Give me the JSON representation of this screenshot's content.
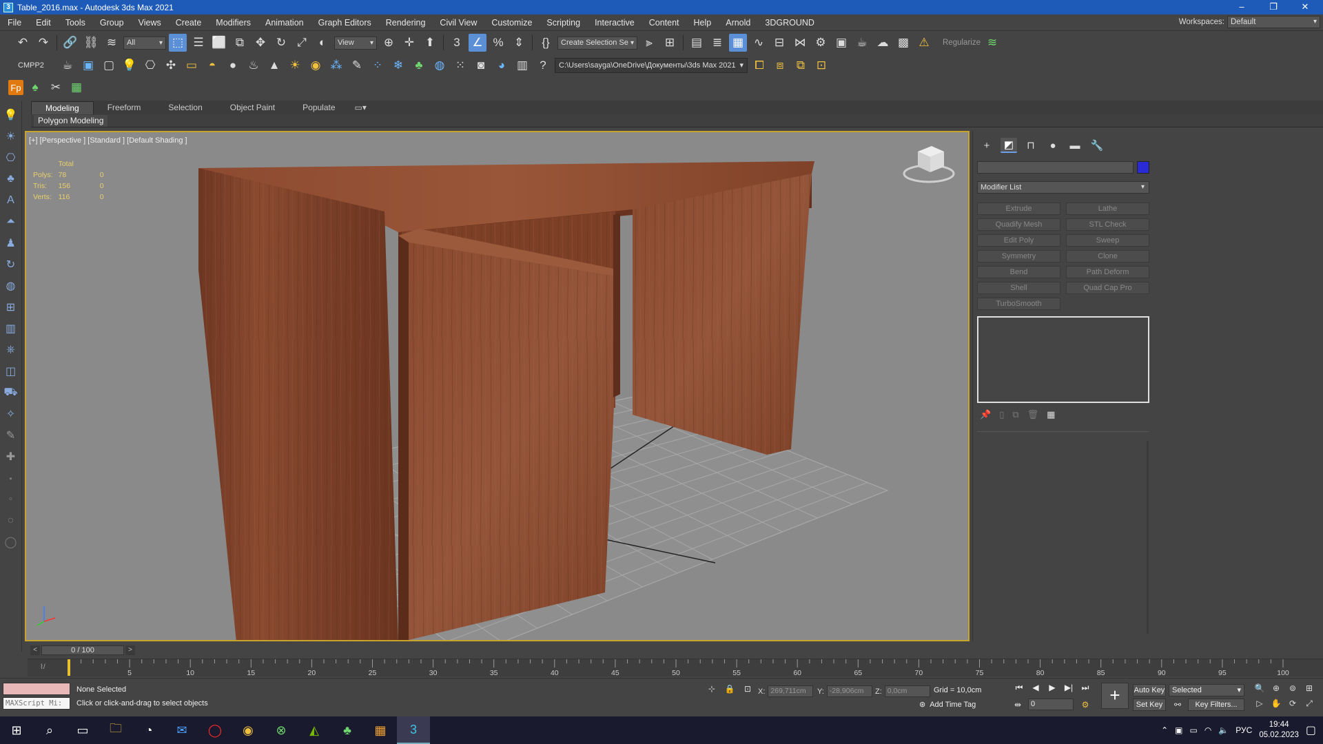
{
  "window": {
    "title": "Table_2016.max - Autodesk 3ds Max 2021",
    "app_icon": "3",
    "controls": [
      "–",
      "❐",
      "✕"
    ]
  },
  "menu": [
    "File",
    "Edit",
    "Tools",
    "Group",
    "Views",
    "Create",
    "Modifiers",
    "Animation",
    "Graph Editors",
    "Rendering",
    "Civil View",
    "Customize",
    "Scripting",
    "Interactive",
    "Content",
    "Help",
    "Arnold",
    "3DGROUND"
  ],
  "workspace": {
    "label": "Workspaces:",
    "value": "Default"
  },
  "toolbar1": {
    "filter_value": "All",
    "view_value": "View",
    "selection_set_placeholder": "Create Selection Se",
    "regularize_label": "Regularize"
  },
  "toolbar2": {
    "cmpp_label": "CMPP2",
    "project_path": "C:\\Users\\sayga\\OneDrive\\Документы\\3ds Max 2021"
  },
  "ribbon": {
    "tabs": [
      "Modeling",
      "Freeform",
      "Selection",
      "Object Paint",
      "Populate"
    ],
    "active_tab": "Modeling",
    "sub_label": "Polygon Modeling"
  },
  "viewport": {
    "label": "[+] [Perspective ] [Standard ] [Default Shading ]",
    "stats": {
      "header": "Total",
      "rows": [
        {
          "label": "Polys:",
          "total": "78",
          "sel": "0"
        },
        {
          "label": "Tris:",
          "total": "156",
          "sel": "0"
        },
        {
          "label": "Verts:",
          "total": "116",
          "sel": "0"
        }
      ]
    },
    "viewcube_labels": [
      "TOP",
      "FRONT"
    ]
  },
  "command_panel": {
    "modifier_list_label": "Modifier List",
    "modifier_buttons": [
      "Extrude",
      "Lathe",
      "Quadify Mesh",
      "STL Check",
      "Edit Poly",
      "Sweep",
      "Symmetry",
      "Clone",
      "Bend",
      "Path Deform",
      "Shell",
      "Quad Cap Pro",
      "TurboSmooth"
    ],
    "object_color": "#2a2ad6"
  },
  "timeline": {
    "frame_display": "0 / 100",
    "ticks": [
      5,
      10,
      15,
      20,
      25,
      30,
      35,
      40,
      45,
      50,
      55,
      60,
      65,
      70,
      75,
      80,
      85,
      90,
      95,
      100
    ],
    "frame_min": 0,
    "frame_max": 100
  },
  "status": {
    "selection": "None Selected",
    "prompt": "Click or click-and-drag to select objects",
    "maxscript_label": "MAXScript Mi:",
    "x_label": "X:",
    "x_value": "269,711cm",
    "y_label": "Y:",
    "y_value": "-28,906cm",
    "z_label": "Z:",
    "z_value": "0,0cm",
    "grid": "Grid = 10,0cm",
    "add_time_tag": "Add Time Tag",
    "auto_key": "Auto Key",
    "set_key": "Set Key",
    "selected_value": "Selected",
    "key_filters": "Key Filters...",
    "frame_value": "0"
  },
  "taskbar": {
    "lang": "РУС",
    "time": "19:44",
    "date": "05.02.2023"
  }
}
